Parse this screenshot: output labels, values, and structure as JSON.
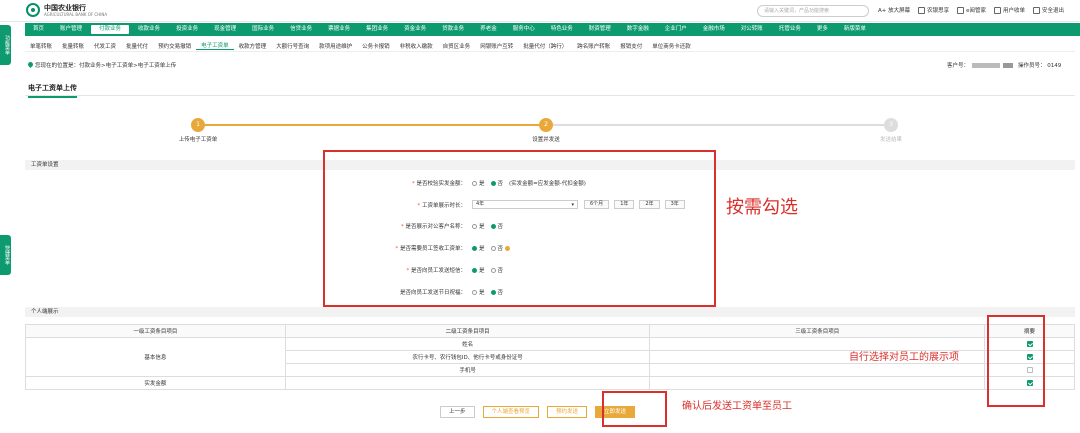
{
  "header": {
    "bank_name": "中国农业银行",
    "bank_sub": "AGRICULTURAL BANK OF CHINA",
    "search_placeholder": "请输入关键词，产品功能搜索",
    "links": [
      "A+ 放大屏幕",
      "农银思享",
      "e阅管家",
      "用户收单",
      "安全退出"
    ]
  },
  "nav": {
    "items": [
      "首页",
      "账户管理",
      "付款业务",
      "收款业务",
      "投资业务",
      "现金管理",
      "国际业务",
      "信贷业务",
      "票据业务",
      "集团业务",
      "资金业务",
      "贷款业务",
      "养老金",
      "服务中心",
      "特色业务",
      "财资管理",
      "数字金融",
      "企业门户",
      "金融市场",
      "对公转账",
      "托管业务",
      "更多",
      "新版菜单"
    ],
    "active_index": 2
  },
  "subnav": {
    "items": [
      "单笔转账",
      "批量转账",
      "代发工资",
      "批量代付",
      "预约交易撤销",
      "电子工资单",
      "收款方管理",
      "大额行号查询",
      "款项用途维护",
      "公务卡报销",
      "非税收入缴款",
      "自贸区业务",
      "网银账户互转",
      "批量代付（跨行）",
      "跨名账户转账",
      "报销支付",
      "单位商务卡还款"
    ],
    "active_index": 5
  },
  "side_tabs": [
    "功能菜单",
    "快捷菜单"
  ],
  "breadcrumb": "您现在的位置是：付款业务>电子工资单>电子工资单上传",
  "account": {
    "label": "客户号：",
    "operator_label": "操作员号：",
    "operator_id": "0149"
  },
  "page_title": "电子工资单上传",
  "steps": [
    {
      "num": "1",
      "label": "上传电子工资单",
      "state": "done"
    },
    {
      "num": "2",
      "label": "设置并发送",
      "state": "done"
    },
    {
      "num": "3",
      "label": "发送结果",
      "state": "todo"
    }
  ],
  "section_settings": "工资单设置",
  "form": {
    "f1": {
      "label": "是否校验实发金额：",
      "yes": "是",
      "no": "否",
      "hint": "(实发金额=应发金额-代扣金额)"
    },
    "f2": {
      "label": "工资单展示时长：",
      "value": "4年",
      "options": [
        "6个月",
        "1年",
        "2年",
        "3年"
      ]
    },
    "f3": {
      "label": "是否展示对公客户名称：",
      "yes": "是",
      "no": "否"
    },
    "f4": {
      "label": "是否需要员工签收工资单：",
      "yes": "是",
      "no": "否"
    },
    "f5": {
      "label": "是否向员工发送短信：",
      "yes": "是",
      "no": "否"
    },
    "f6": {
      "label": "是否向员工发送节日祝福：",
      "yes": "是",
      "no": "否"
    }
  },
  "section_display": "个人端展示",
  "table": {
    "headers": [
      "一级工资条目项目",
      "二级工资条目项目",
      "三级工资条目项目",
      "摘要"
    ],
    "group_basic": "基本信息",
    "basic_rows": [
      "姓名",
      "农行卡号、农行钱包ID、他行卡号或身份证号",
      "手机号"
    ],
    "row_paid": "实发金额"
  },
  "buttons": {
    "prev": "上一步",
    "preview": "个人端查看预览",
    "schedule": "预约发送",
    "send_now": "立即发送"
  },
  "annotations": {
    "a1": "按需勾选",
    "a2": "自行选择对员工的展示项",
    "a3": "确认后发送工资单至员工"
  },
  "colors": {
    "brand_green": "#0d9a6e",
    "accent_orange": "#e8a93a",
    "annotation_red": "#d9302c"
  }
}
